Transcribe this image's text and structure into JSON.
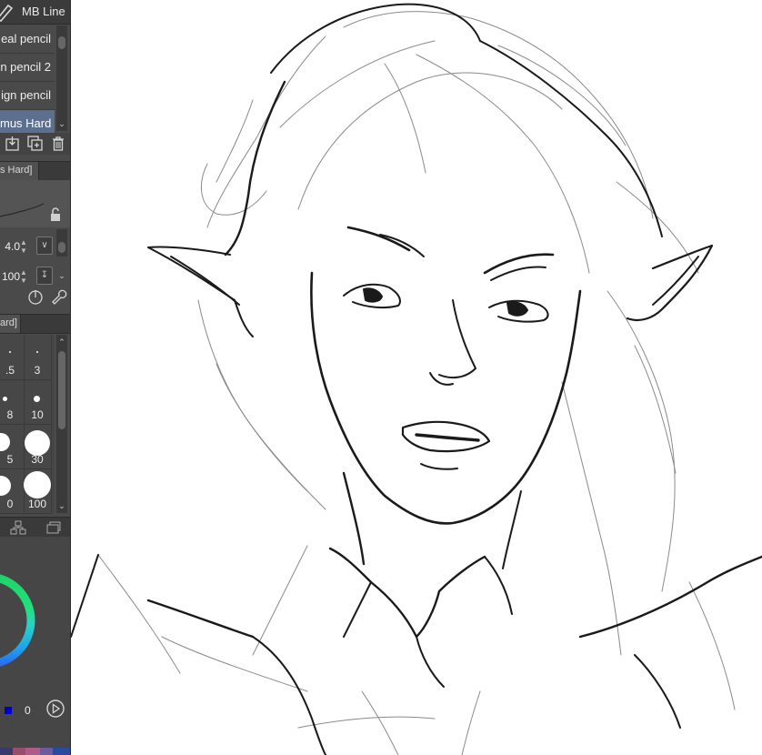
{
  "panel": {
    "title": "MB Line",
    "subtools": [
      {
        "label": "eal pencil",
        "selected": false
      },
      {
        "label": "n pencil 2",
        "selected": false
      },
      {
        "label": "ign pencil",
        "selected": false
      },
      {
        "label": "mus Hard",
        "selected": true
      }
    ],
    "tool_property_tab": "s Hard]",
    "brush_size_tab": "ard]",
    "properties": {
      "brush_size_value": "4.0",
      "opacity_value": "100"
    },
    "brush_sizes": [
      {
        "label": ".5"
      },
      {
        "label": "3"
      },
      {
        "label": "8"
      },
      {
        "label": "10"
      },
      {
        "label": "5"
      },
      {
        "label": "30"
      },
      {
        "label": "0"
      },
      {
        "label": "100"
      }
    ],
    "color_readout": "0"
  },
  "colors": {
    "panel_bg": "#4a4a4a",
    "selected_item": "#5d6f8e",
    "canvas_bg": "#ffffff",
    "ink": "#1a1a1a",
    "color_wheel_green": "#2fe060",
    "color_wheel_cyan": "#23c8e8",
    "main_color": "#0000cc"
  }
}
